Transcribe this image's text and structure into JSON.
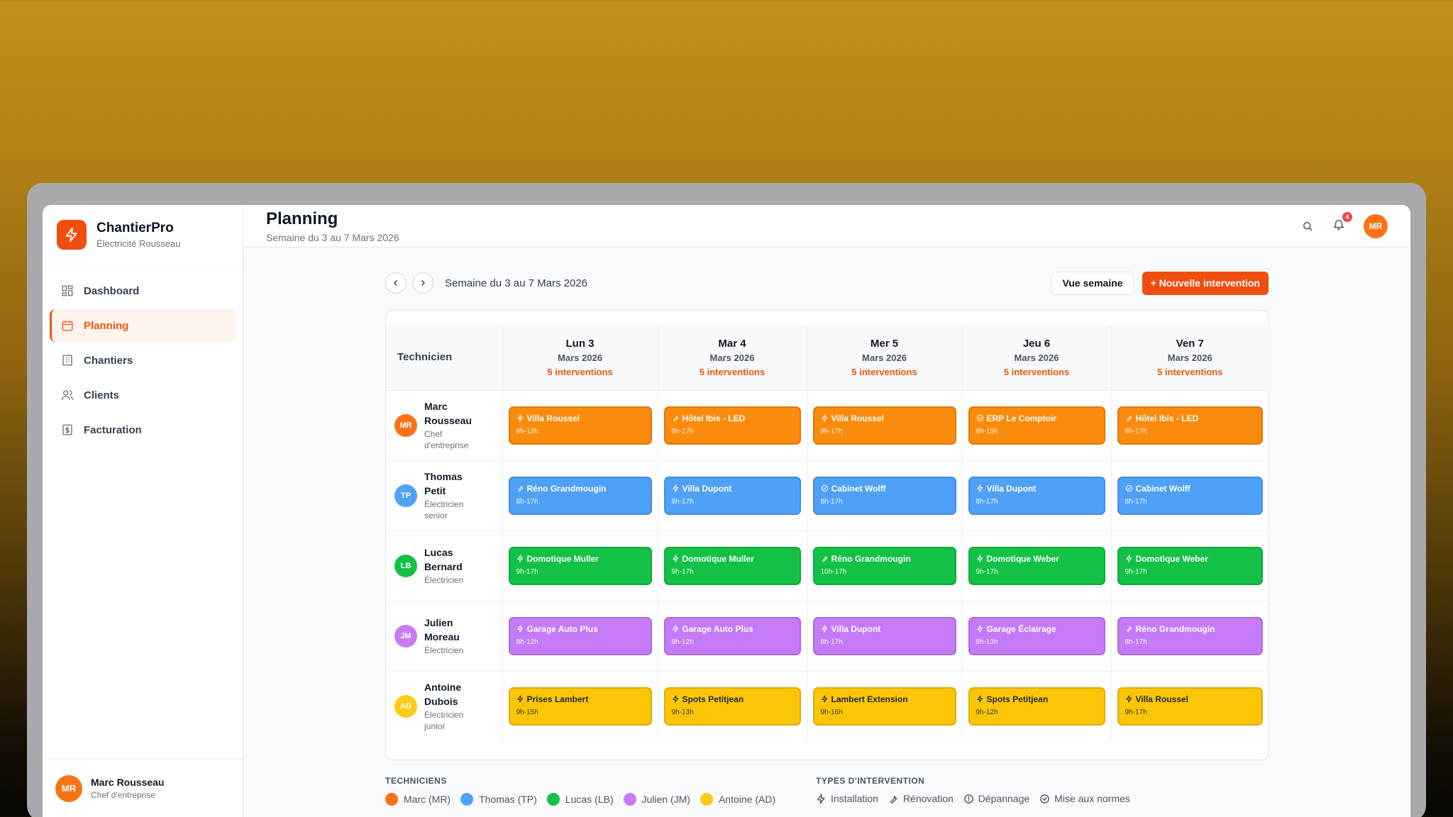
{
  "app": {
    "name": "ChantierPro",
    "company": "Électricité Rousseau"
  },
  "sidebar": {
    "items": [
      {
        "label": "Dashboard",
        "icon": "dashboard-icon"
      },
      {
        "label": "Planning",
        "icon": "calendar-icon",
        "active": true
      },
      {
        "label": "Chantiers",
        "icon": "building-icon"
      },
      {
        "label": "Clients",
        "icon": "users-icon"
      },
      {
        "label": "Facturation",
        "icon": "invoice-icon"
      }
    ],
    "user": {
      "initials": "MR",
      "name": "Marc Rousseau",
      "role": "Chef d'entreprise"
    }
  },
  "header": {
    "title": "Planning",
    "subtitle": "Semaine du 3 au 7 Mars 2026",
    "notifications": "4",
    "avatar": "MR"
  },
  "toolbar": {
    "week_label": "Semaine du 3 au 7 Mars 2026",
    "view_label": "Vue semaine",
    "new_label": "+ Nouvelle intervention"
  },
  "grid": {
    "tech_header": "Technicien",
    "days": [
      {
        "name": "Lun 3",
        "month": "Mars 2026",
        "count": "5 interventions"
      },
      {
        "name": "Mar 4",
        "month": "Mars 2026",
        "count": "5 interventions"
      },
      {
        "name": "Mer 5",
        "month": "Mars 2026",
        "count": "5 interventions"
      },
      {
        "name": "Jeu 6",
        "month": "Mars 2026",
        "count": "5 interventions"
      },
      {
        "name": "Ven 7",
        "month": "Mars 2026",
        "count": "5 interventions"
      }
    ],
    "rows": [
      {
        "initials": "MR",
        "name": "Marc Rousseau",
        "role": "Chef d'entreprise",
        "color": "#f97316",
        "card_color": "#fb8b0c",
        "text": "#ffffff",
        "cards": [
          {
            "title": "Villa Roussel",
            "hours": "8h-12h",
            "type": "installation"
          },
          {
            "title": "Hôtel Ibis - LED",
            "hours": "8h-17h",
            "type": "renovation"
          },
          {
            "title": "Villa Roussel",
            "hours": "8h-17h",
            "type": "installation"
          },
          {
            "title": "ERP Le Comptoir",
            "hours": "8h-15h",
            "type": "conformite"
          },
          {
            "title": "Hôtel Ibis - LED",
            "hours": "8h-17h",
            "type": "renovation"
          }
        ]
      },
      {
        "initials": "TP",
        "name": "Thomas Petit",
        "role": "Électricien senior",
        "color": "#4fa3f7",
        "card_color": "#4fa0f8",
        "text": "#ffffff",
        "cards": [
          {
            "title": "Réno Grandmougin",
            "hours": "8h-17h",
            "type": "renovation"
          },
          {
            "title": "Villa Dupont",
            "hours": "8h-17h",
            "type": "installation"
          },
          {
            "title": "Cabinet Wolff",
            "hours": "8h-17h",
            "type": "conformite"
          },
          {
            "title": "Villa Dupont",
            "hours": "8h-17h",
            "type": "installation"
          },
          {
            "title": "Cabinet Wolff",
            "hours": "8h-17h",
            "type": "conformite"
          }
        ]
      },
      {
        "initials": "LB",
        "name": "Lucas Bernard",
        "role": "Électricien",
        "color": "#16c048",
        "card_color": "#14c147",
        "text": "#ffffff",
        "cards": [
          {
            "title": "Domotique Muller",
            "hours": "9h-17h",
            "type": "installation"
          },
          {
            "title": "Domotique Muller",
            "hours": "9h-17h",
            "type": "installation"
          },
          {
            "title": "Réno Grandmougin",
            "hours": "10h-17h",
            "type": "renovation"
          },
          {
            "title": "Domotique Weber",
            "hours": "9h-17h",
            "type": "installation"
          },
          {
            "title": "Domotique Weber",
            "hours": "9h-17h",
            "type": "installation"
          }
        ]
      },
      {
        "initials": "JM",
        "name": "Julien Moreau",
        "role": "Électricien",
        "color": "#c77cf5",
        "card_color": "#c57af7",
        "text": "#ffffff",
        "cards": [
          {
            "title": "Garage Auto Plus",
            "hours": "8h-12h",
            "type": "installation"
          },
          {
            "title": "Garage Auto Plus",
            "hours": "8h-12h",
            "type": "installation"
          },
          {
            "title": "Villa Dupont",
            "hours": "8h-17h",
            "type": "installation"
          },
          {
            "title": "Garage Éclairage",
            "hours": "8h-13h",
            "type": "installation"
          },
          {
            "title": "Réno Grandmougin",
            "hours": "8h-17h",
            "type": "renovation"
          }
        ]
      },
      {
        "initials": "AD",
        "name": "Antoine Dubois",
        "role": "Électricien junior",
        "color": "#facc15",
        "card_color": "#fcc508",
        "text": "#1f2937",
        "cards": [
          {
            "title": "Prises Lambert",
            "hours": "9h-15h",
            "type": "installation"
          },
          {
            "title": "Spots Petitjean",
            "hours": "9h-13h",
            "type": "installation"
          },
          {
            "title": "Lambert Extension",
            "hours": "9h-16h",
            "type": "installation"
          },
          {
            "title": "Spots Petitjean",
            "hours": "9h-12h",
            "type": "installation"
          },
          {
            "title": "Villa Roussel",
            "hours": "9h-17h",
            "type": "installation"
          }
        ]
      }
    ]
  },
  "legend": {
    "tech_heading": "TECHNICIENS",
    "techs": [
      {
        "label": "Marc (MR)",
        "color": "#f97316"
      },
      {
        "label": "Thomas (TP)",
        "color": "#4fa3f7"
      },
      {
        "label": "Lucas (LB)",
        "color": "#16c048"
      },
      {
        "label": "Julien (JM)",
        "color": "#c77cf5"
      },
      {
        "label": "Antoine (AD)",
        "color": "#facc15"
      }
    ],
    "types_heading": "TYPES D'INTERVENTION",
    "types": [
      {
        "label": "Installation",
        "icon": "installation"
      },
      {
        "label": "Rénovation",
        "icon": "renovation"
      },
      {
        "label": "Dépannage",
        "icon": "depannage"
      },
      {
        "label": "Mise aux normes",
        "icon": "conformite"
      }
    ]
  }
}
